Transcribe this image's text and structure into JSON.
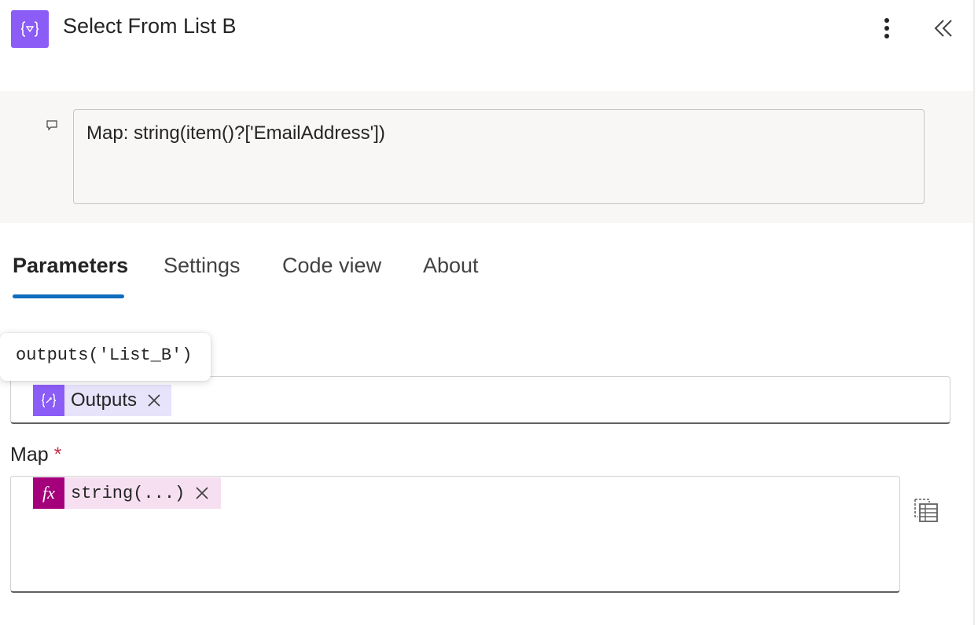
{
  "header": {
    "title": "Select From List B",
    "icon": "data-operation-icon",
    "icon_color": "#8b5cf6"
  },
  "comment": {
    "text": "Map: string(item()?['EmailAddress'])"
  },
  "tabs": [
    {
      "label": "Parameters",
      "active": true
    },
    {
      "label": "Settings",
      "active": false
    },
    {
      "label": "Code view",
      "active": false
    },
    {
      "label": "About",
      "active": false
    }
  ],
  "tooltip": {
    "text": "outputs('List_B')"
  },
  "from_field": {
    "token": {
      "label": "Outputs",
      "icon": "dynamic-content-icon",
      "color": "#8b5cf6"
    }
  },
  "map": {
    "label": "Map",
    "required": "*",
    "token": {
      "label": "string(...)",
      "icon": "fx-icon",
      "icon_text": "fx",
      "color": "#a4007c"
    }
  },
  "colors": {
    "accent": "#0f6cbd",
    "required": "#c4314b",
    "comment_background": "#f8f7f6"
  }
}
